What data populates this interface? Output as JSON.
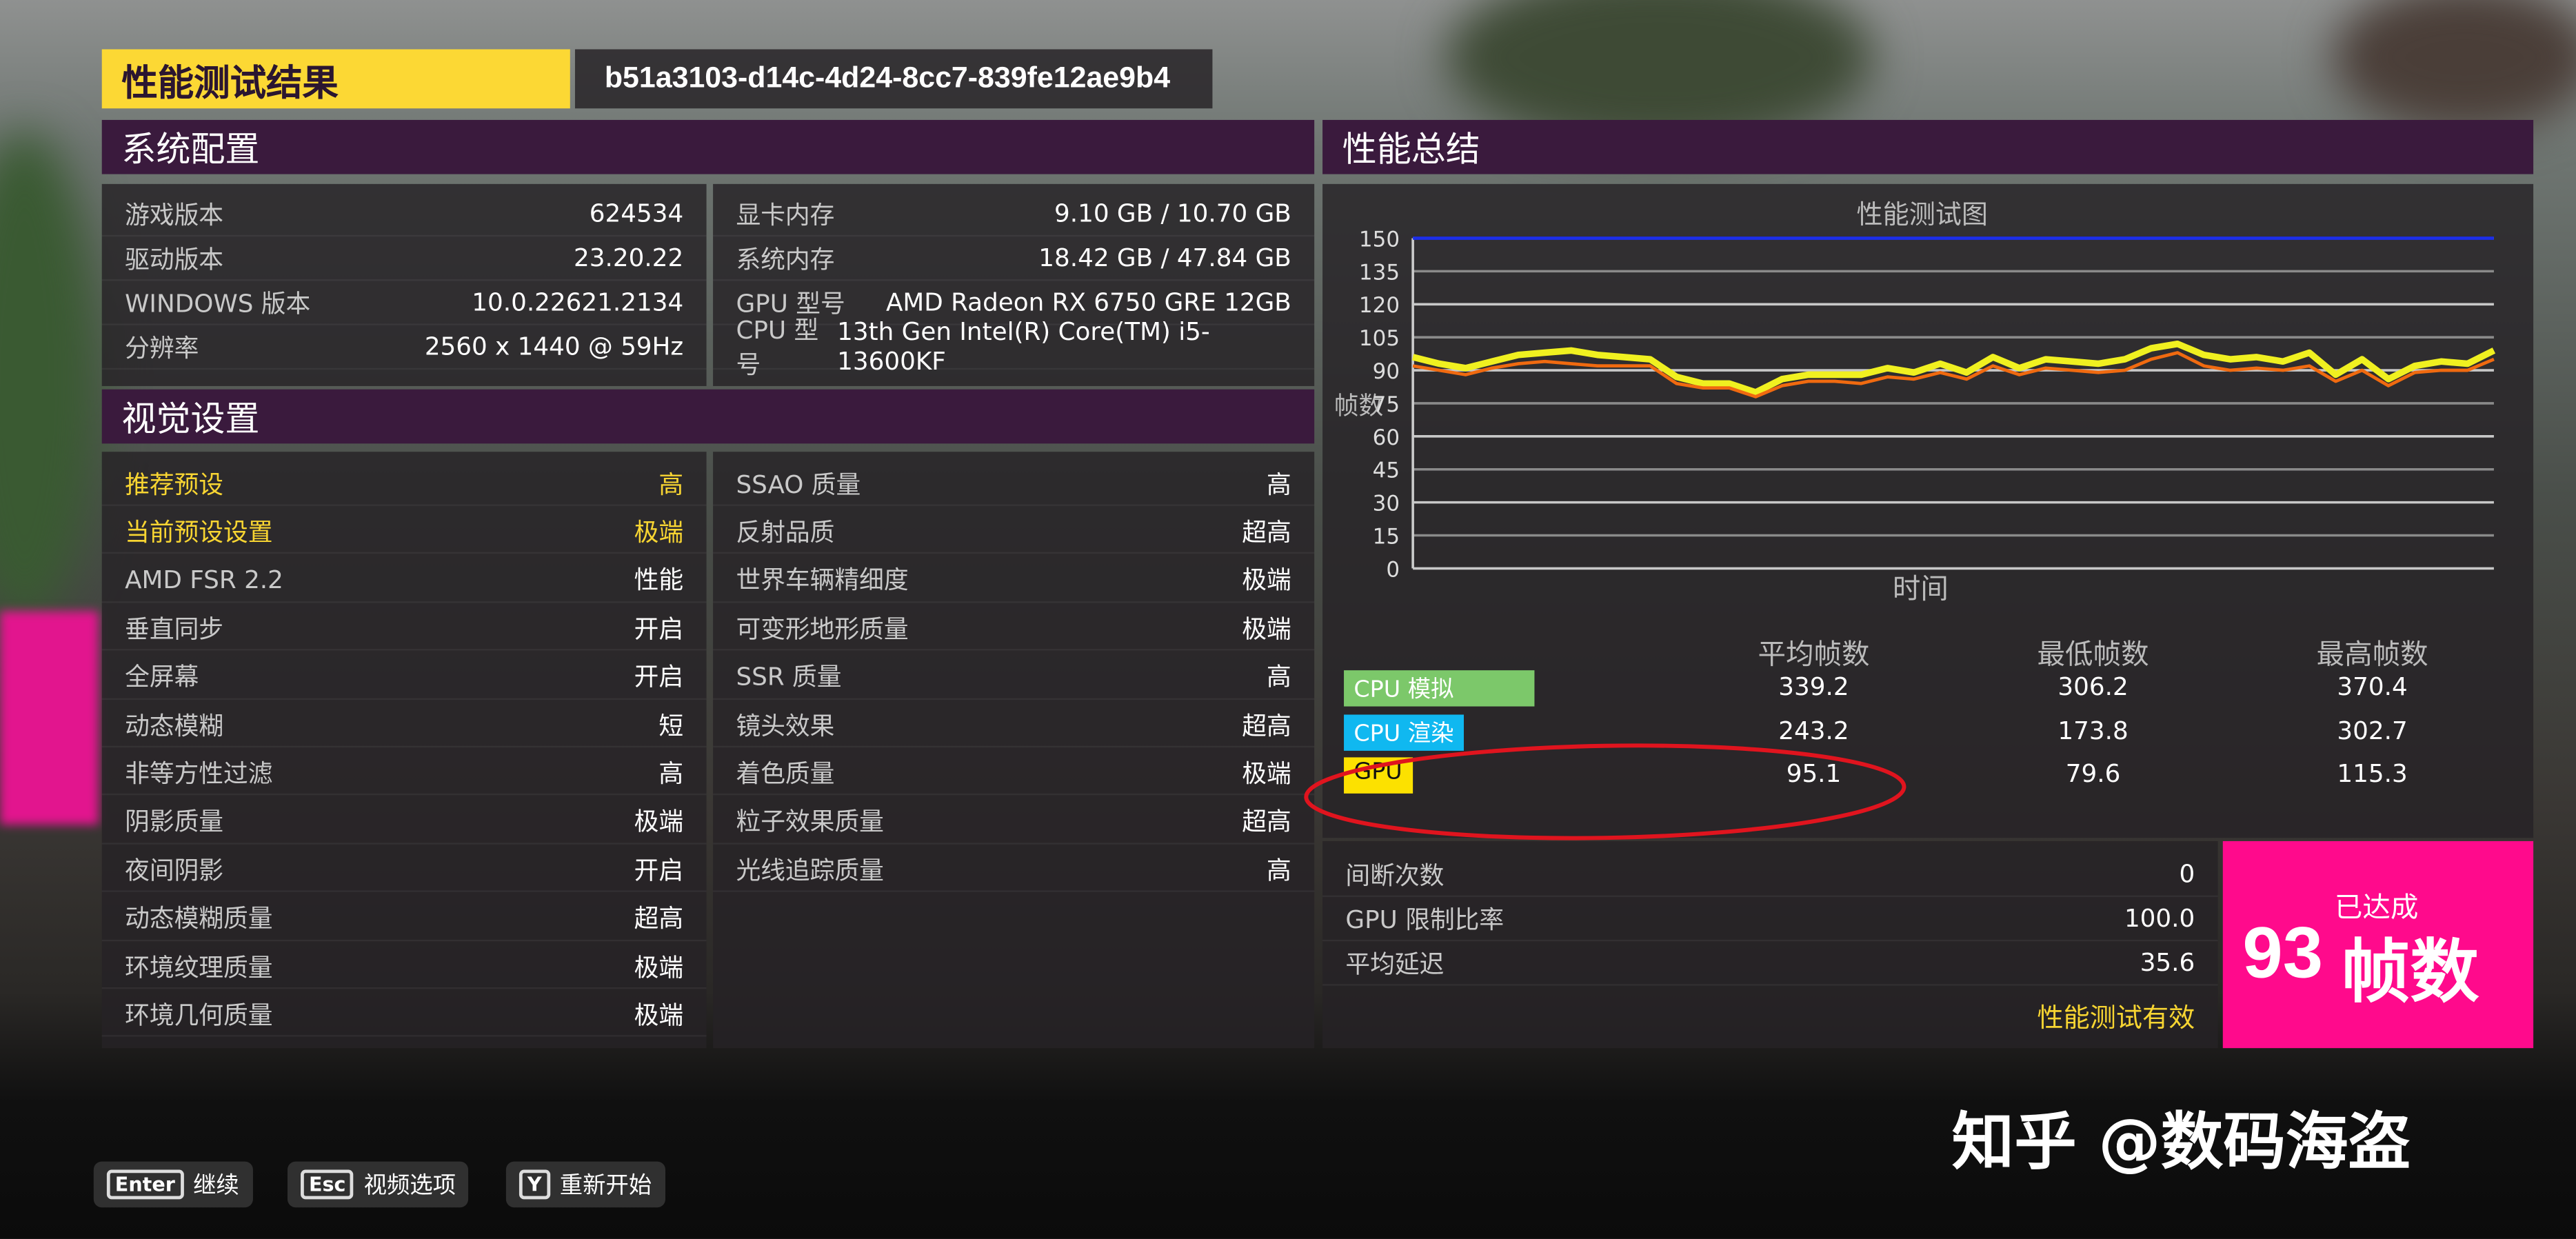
{
  "header": {
    "title": "性能测试结果",
    "run_id": "b51a3103-d14c-4d24-8cc7-839fe12ae9b4"
  },
  "system": {
    "title": "系统配置",
    "left": [
      {
        "label": "游戏版本",
        "value": "624534"
      },
      {
        "label": "驱动版本",
        "value": "23.20.22"
      },
      {
        "label": "WINDOWS 版本",
        "value": "10.0.22621.2134"
      },
      {
        "label": "分辨率",
        "value": "2560 x 1440 @ 59Hz"
      }
    ],
    "right": [
      {
        "label": "显卡内存",
        "value": "9.10 GB / 10.70 GB"
      },
      {
        "label": "系统内存",
        "value": "18.42 GB / 47.84 GB"
      },
      {
        "label": "GPU 型号",
        "value": "AMD Radeon RX 6750 GRE 12GB"
      },
      {
        "label": "CPU 型号",
        "value": "13th Gen Intel(R) Core(TM) i5-13600KF"
      }
    ]
  },
  "visual": {
    "title": "视觉设置",
    "left": [
      {
        "label": "推荐预设",
        "value": "高",
        "highlight": true
      },
      {
        "label": "当前预设设置",
        "value": "极端",
        "highlight": true
      },
      {
        "label": "AMD FSR 2.2",
        "value": "性能"
      },
      {
        "label": "垂直同步",
        "value": "开启"
      },
      {
        "label": "全屏幕",
        "value": "开启"
      },
      {
        "label": "动态模糊",
        "value": "短"
      },
      {
        "label": "非等方性过滤",
        "value": "高"
      },
      {
        "label": "阴影质量",
        "value": "极端"
      },
      {
        "label": "夜间阴影",
        "value": "开启"
      },
      {
        "label": "动态模糊质量",
        "value": "超高"
      },
      {
        "label": "环境纹理质量",
        "value": "极端"
      },
      {
        "label": "环境几何质量",
        "value": "极端"
      }
    ],
    "right": [
      {
        "label": "SSAO 质量",
        "value": "高"
      },
      {
        "label": "反射品质",
        "value": "超高"
      },
      {
        "label": "世界车辆精细度",
        "value": "极端"
      },
      {
        "label": "可变形地形质量",
        "value": "极端"
      },
      {
        "label": "SSR 质量",
        "value": "高"
      },
      {
        "label": "镜头效果",
        "value": "超高"
      },
      {
        "label": "着色质量",
        "value": "极端"
      },
      {
        "label": "粒子效果质量",
        "value": "超高"
      },
      {
        "label": "光线追踪质量",
        "value": "高"
      }
    ]
  },
  "summary": {
    "title": "性能总结",
    "columns": [
      "平均帧数",
      "最低帧数",
      "最高帧数"
    ],
    "rows": [
      {
        "label": "CPU 模拟",
        "color": "#7cc86a",
        "values": [
          "339.2",
          "306.2",
          "370.4"
        ]
      },
      {
        "label": "CPU 渲染",
        "color": "#10b8f0",
        "values": [
          "243.2",
          "173.8",
          "302.7"
        ]
      },
      {
        "label": "GPU",
        "color": "#fce100",
        "values": [
          "95.1",
          "79.6",
          "115.3"
        ]
      }
    ],
    "stats": [
      {
        "label": "间断次数",
        "value": "0"
      },
      {
        "label": "GPU 限制比率",
        "value": "100.0"
      },
      {
        "label": "平均延迟",
        "value": "35.6"
      }
    ],
    "valid": "性能测试有效",
    "achieved_label": "已达成",
    "achieved_value": "93",
    "achieved_unit": "帧数",
    "accent": "#ff0a8c",
    "annotation_color": "#e0141e"
  },
  "chart_data": {
    "type": "line",
    "title": "性能测试图",
    "xlabel": "时间",
    "ylabel": "帧数",
    "ylim": [
      0,
      150
    ],
    "yticks": [
      "0",
      "15",
      "30",
      "45",
      "60",
      "75",
      "90",
      "105",
      "120",
      "135",
      "150"
    ],
    "grid": true,
    "series": [
      {
        "color": "#1c2ee8",
        "values": [
          150,
          150,
          150,
          150,
          150,
          150,
          150,
          150,
          150,
          150,
          150,
          150,
          150,
          150,
          150,
          150,
          150,
          150,
          150,
          150,
          150,
          150,
          150,
          150,
          150,
          150,
          150,
          150,
          150,
          150,
          150,
          150,
          150,
          150,
          150,
          150,
          150,
          150,
          150,
          150,
          150,
          150
        ]
      },
      {
        "color": "#f0f020",
        "values": [
          96,
          93,
          91,
          94,
          97,
          98,
          99,
          97,
          96,
          95,
          87,
          84,
          84,
          80,
          86,
          88,
          88,
          88,
          91,
          89,
          93,
          89,
          96,
          91,
          95,
          94,
          93,
          95,
          100,
          102,
          97,
          95,
          96,
          94,
          98,
          88,
          95,
          86,
          92,
          94,
          93,
          99
        ]
      },
      {
        "color": "#f06a10",
        "values": [
          92,
          90,
          88,
          91,
          93,
          94,
          93,
          92,
          92,
          92,
          84,
          82,
          82,
          78,
          83,
          85,
          85,
          84,
          87,
          86,
          89,
          86,
          92,
          88,
          91,
          90,
          89,
          90,
          95,
          98,
          92,
          90,
          91,
          90,
          92,
          85,
          90,
          83,
          89,
          90,
          90,
          95
        ]
      }
    ]
  },
  "footer": {
    "buttons": [
      {
        "key": "Enter",
        "label": "继续"
      },
      {
        "key": "Esc",
        "label": "视频选项"
      },
      {
        "key": "Y",
        "label": "重新开始"
      }
    ],
    "watermark": "知乎 @数码海盗"
  }
}
